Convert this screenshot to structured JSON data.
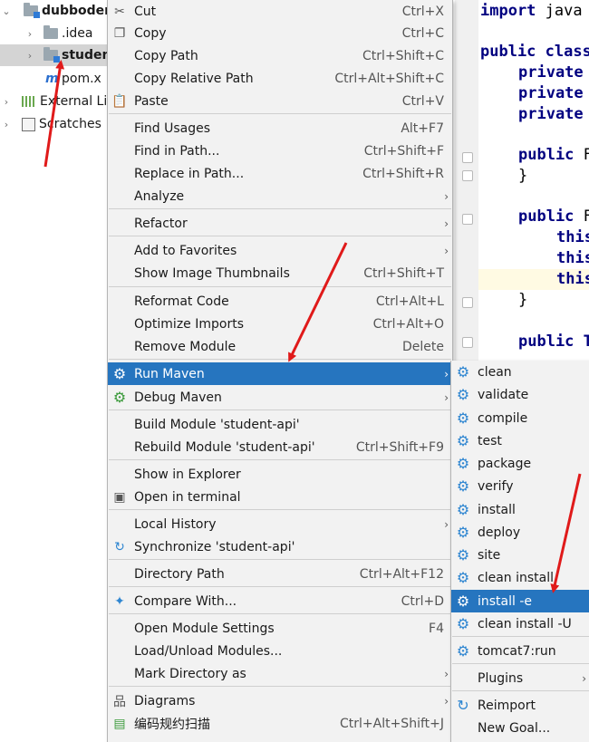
{
  "project_tree": {
    "items": [
      {
        "label": "dubbodem",
        "expand": "⌄",
        "bold": true
      },
      {
        "label": ".idea",
        "expand": "›"
      },
      {
        "label": "studen",
        "expand": "›",
        "bold": true
      },
      {
        "label": "pom.x",
        "expand": ""
      },
      {
        "label": "External Li",
        "expand": "›"
      },
      {
        "label": "Scratches",
        "expand": "›"
      }
    ]
  },
  "editor": {
    "lines": [
      {
        "kw": "import ",
        "rest": "java"
      },
      {
        "kw": "public ",
        "rest": "class"
      },
      {
        "kw": "private",
        "rest": ""
      },
      {
        "kw": "private",
        "rest": ""
      },
      {
        "kw": "private",
        "rest": ""
      },
      {
        "kw": "public ",
        "rest": "F"
      },
      {
        "kw": "",
        "rest": "}"
      },
      {
        "kw": "public ",
        "rest": "F"
      },
      {
        "kw": "",
        "rest": "this"
      },
      {
        "kw": "",
        "rest": "this"
      },
      {
        "kw": "",
        "rest": "this"
      },
      {
        "kw": "",
        "rest": "}"
      },
      {
        "kw": "public ",
        "rest": "T"
      }
    ]
  },
  "context_menu": {
    "items": [
      {
        "label": "Cut",
        "shortcut": "Ctrl+X",
        "icon": "scissors-icon"
      },
      {
        "label": "Copy",
        "shortcut": "Ctrl+C",
        "icon": "copy-icon"
      },
      {
        "label": "Copy Path",
        "shortcut": "Ctrl+Shift+C"
      },
      {
        "label": "Copy Relative Path",
        "shortcut": "Ctrl+Alt+Shift+C"
      },
      {
        "label": "Paste",
        "shortcut": "Ctrl+V",
        "icon": "paste-icon"
      },
      {
        "label": "Find Usages",
        "shortcut": "Alt+F7"
      },
      {
        "label": "Find in Path...",
        "shortcut": "Ctrl+Shift+F"
      },
      {
        "label": "Replace in Path...",
        "shortcut": "Ctrl+Shift+R"
      },
      {
        "label": "Analyze",
        "submenu": "›"
      },
      {
        "label": "Refactor",
        "submenu": "›"
      },
      {
        "label": "Add to Favorites",
        "submenu": "›"
      },
      {
        "label": "Show Image Thumbnails",
        "shortcut": "Ctrl+Shift+T"
      },
      {
        "label": "Reformat Code",
        "shortcut": "Ctrl+Alt+L"
      },
      {
        "label": "Optimize Imports",
        "shortcut": "Ctrl+Alt+O"
      },
      {
        "label": "Remove Module",
        "shortcut": "Delete"
      },
      {
        "label": "Run Maven",
        "submenu": "›",
        "icon": "maven-gear-icon",
        "active": true
      },
      {
        "label": "Debug Maven",
        "submenu": "›",
        "icon": "debug-gear-icon"
      },
      {
        "label": "Build Module 'student-api'"
      },
      {
        "label": "Rebuild Module 'student-api'",
        "shortcut": "Ctrl+Shift+F9"
      },
      {
        "label": "Show in Explorer"
      },
      {
        "label": "Open in terminal",
        "icon": "terminal-icon"
      },
      {
        "label": "Local History",
        "submenu": "›"
      },
      {
        "label": "Synchronize 'student-api'",
        "icon": "sync-icon"
      },
      {
        "label": "Directory Path",
        "shortcut": "Ctrl+Alt+F12"
      },
      {
        "label": "Compare With...",
        "shortcut": "Ctrl+D",
        "icon": "compare-icon"
      },
      {
        "label": "Open Module Settings",
        "shortcut": "F4"
      },
      {
        "label": "Load/Unload Modules..."
      },
      {
        "label": "Mark Directory as",
        "submenu": "›"
      },
      {
        "label": "Diagrams",
        "submenu": "›",
        "icon": "diagram-icon"
      },
      {
        "label": "编码规约扫描",
        "shortcut": "Ctrl+Alt+Shift+J",
        "icon": "scan-icon"
      }
    ]
  },
  "maven_submenu": {
    "items": [
      {
        "label": "clean"
      },
      {
        "label": "validate"
      },
      {
        "label": "compile"
      },
      {
        "label": "test"
      },
      {
        "label": "package"
      },
      {
        "label": "verify"
      },
      {
        "label": "install"
      },
      {
        "label": "deploy"
      },
      {
        "label": "site"
      },
      {
        "label": "clean install"
      },
      {
        "label": "install -e",
        "active": true
      },
      {
        "label": "clean install -U"
      },
      {
        "label": "tomcat7:run"
      },
      {
        "label": "Plugins",
        "submenu": "›"
      },
      {
        "label": "Reimport"
      },
      {
        "label": "New Goal..."
      }
    ]
  },
  "colors": {
    "menu_bg": "#f2f2f2",
    "selection": "#2675bf",
    "annotation_arrow": "#e01a1a"
  }
}
